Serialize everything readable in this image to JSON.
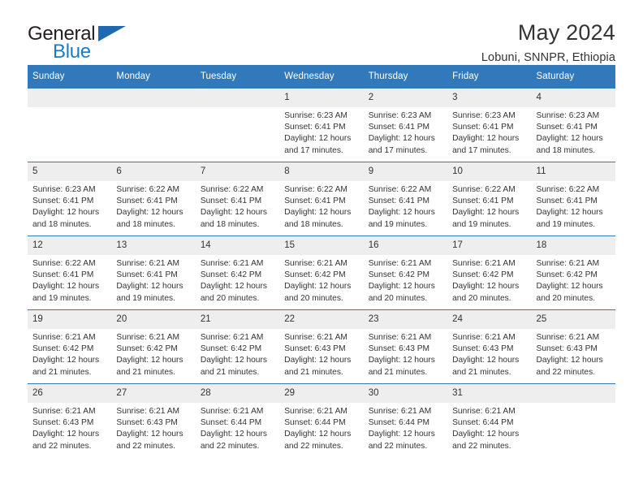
{
  "brand": {
    "name_top": "General",
    "name_bottom": "Blue",
    "logo_icon": "blue-triangle-icon"
  },
  "header": {
    "title": "May 2024",
    "subtitle": "Lobuni, SNNPR, Ethiopia"
  },
  "calendar": {
    "weekday_headers": [
      "Sunday",
      "Monday",
      "Tuesday",
      "Wednesday",
      "Thursday",
      "Friday",
      "Saturday"
    ],
    "colors": {
      "header_blue": "#3279bb",
      "daynum_band": "#eeeeee",
      "text": "#333333",
      "brand_blue": "#1f7ac4"
    },
    "weeks": [
      [
        {
          "day": "",
          "lines": []
        },
        {
          "day": "",
          "lines": []
        },
        {
          "day": "",
          "lines": []
        },
        {
          "day": "1",
          "lines": [
            "Sunrise: 6:23 AM",
            "Sunset: 6:41 PM",
            "Daylight: 12 hours",
            "and 17 minutes."
          ]
        },
        {
          "day": "2",
          "lines": [
            "Sunrise: 6:23 AM",
            "Sunset: 6:41 PM",
            "Daylight: 12 hours",
            "and 17 minutes."
          ]
        },
        {
          "day": "3",
          "lines": [
            "Sunrise: 6:23 AM",
            "Sunset: 6:41 PM",
            "Daylight: 12 hours",
            "and 17 minutes."
          ]
        },
        {
          "day": "4",
          "lines": [
            "Sunrise: 6:23 AM",
            "Sunset: 6:41 PM",
            "Daylight: 12 hours",
            "and 18 minutes."
          ]
        }
      ],
      [
        {
          "day": "5",
          "lines": [
            "Sunrise: 6:23 AM",
            "Sunset: 6:41 PM",
            "Daylight: 12 hours",
            "and 18 minutes."
          ]
        },
        {
          "day": "6",
          "lines": [
            "Sunrise: 6:22 AM",
            "Sunset: 6:41 PM",
            "Daylight: 12 hours",
            "and 18 minutes."
          ]
        },
        {
          "day": "7",
          "lines": [
            "Sunrise: 6:22 AM",
            "Sunset: 6:41 PM",
            "Daylight: 12 hours",
            "and 18 minutes."
          ]
        },
        {
          "day": "8",
          "lines": [
            "Sunrise: 6:22 AM",
            "Sunset: 6:41 PM",
            "Daylight: 12 hours",
            "and 18 minutes."
          ]
        },
        {
          "day": "9",
          "lines": [
            "Sunrise: 6:22 AM",
            "Sunset: 6:41 PM",
            "Daylight: 12 hours",
            "and 19 minutes."
          ]
        },
        {
          "day": "10",
          "lines": [
            "Sunrise: 6:22 AM",
            "Sunset: 6:41 PM",
            "Daylight: 12 hours",
            "and 19 minutes."
          ]
        },
        {
          "day": "11",
          "lines": [
            "Sunrise: 6:22 AM",
            "Sunset: 6:41 PM",
            "Daylight: 12 hours",
            "and 19 minutes."
          ]
        }
      ],
      [
        {
          "day": "12",
          "lines": [
            "Sunrise: 6:22 AM",
            "Sunset: 6:41 PM",
            "Daylight: 12 hours",
            "and 19 minutes."
          ]
        },
        {
          "day": "13",
          "lines": [
            "Sunrise: 6:21 AM",
            "Sunset: 6:41 PM",
            "Daylight: 12 hours",
            "and 19 minutes."
          ]
        },
        {
          "day": "14",
          "lines": [
            "Sunrise: 6:21 AM",
            "Sunset: 6:42 PM",
            "Daylight: 12 hours",
            "and 20 minutes."
          ]
        },
        {
          "day": "15",
          "lines": [
            "Sunrise: 6:21 AM",
            "Sunset: 6:42 PM",
            "Daylight: 12 hours",
            "and 20 minutes."
          ]
        },
        {
          "day": "16",
          "lines": [
            "Sunrise: 6:21 AM",
            "Sunset: 6:42 PM",
            "Daylight: 12 hours",
            "and 20 minutes."
          ]
        },
        {
          "day": "17",
          "lines": [
            "Sunrise: 6:21 AM",
            "Sunset: 6:42 PM",
            "Daylight: 12 hours",
            "and 20 minutes."
          ]
        },
        {
          "day": "18",
          "lines": [
            "Sunrise: 6:21 AM",
            "Sunset: 6:42 PM",
            "Daylight: 12 hours",
            "and 20 minutes."
          ]
        }
      ],
      [
        {
          "day": "19",
          "lines": [
            "Sunrise: 6:21 AM",
            "Sunset: 6:42 PM",
            "Daylight: 12 hours",
            "and 21 minutes."
          ]
        },
        {
          "day": "20",
          "lines": [
            "Sunrise: 6:21 AM",
            "Sunset: 6:42 PM",
            "Daylight: 12 hours",
            "and 21 minutes."
          ]
        },
        {
          "day": "21",
          "lines": [
            "Sunrise: 6:21 AM",
            "Sunset: 6:42 PM",
            "Daylight: 12 hours",
            "and 21 minutes."
          ]
        },
        {
          "day": "22",
          "lines": [
            "Sunrise: 6:21 AM",
            "Sunset: 6:43 PM",
            "Daylight: 12 hours",
            "and 21 minutes."
          ]
        },
        {
          "day": "23",
          "lines": [
            "Sunrise: 6:21 AM",
            "Sunset: 6:43 PM",
            "Daylight: 12 hours",
            "and 21 minutes."
          ]
        },
        {
          "day": "24",
          "lines": [
            "Sunrise: 6:21 AM",
            "Sunset: 6:43 PM",
            "Daylight: 12 hours",
            "and 21 minutes."
          ]
        },
        {
          "day": "25",
          "lines": [
            "Sunrise: 6:21 AM",
            "Sunset: 6:43 PM",
            "Daylight: 12 hours",
            "and 22 minutes."
          ]
        }
      ],
      [
        {
          "day": "26",
          "lines": [
            "Sunrise: 6:21 AM",
            "Sunset: 6:43 PM",
            "Daylight: 12 hours",
            "and 22 minutes."
          ]
        },
        {
          "day": "27",
          "lines": [
            "Sunrise: 6:21 AM",
            "Sunset: 6:43 PM",
            "Daylight: 12 hours",
            "and 22 minutes."
          ]
        },
        {
          "day": "28",
          "lines": [
            "Sunrise: 6:21 AM",
            "Sunset: 6:44 PM",
            "Daylight: 12 hours",
            "and 22 minutes."
          ]
        },
        {
          "day": "29",
          "lines": [
            "Sunrise: 6:21 AM",
            "Sunset: 6:44 PM",
            "Daylight: 12 hours",
            "and 22 minutes."
          ]
        },
        {
          "day": "30",
          "lines": [
            "Sunrise: 6:21 AM",
            "Sunset: 6:44 PM",
            "Daylight: 12 hours",
            "and 22 minutes."
          ]
        },
        {
          "day": "31",
          "lines": [
            "Sunrise: 6:21 AM",
            "Sunset: 6:44 PM",
            "Daylight: 12 hours",
            "and 22 minutes."
          ]
        },
        {
          "day": "",
          "lines": []
        }
      ]
    ]
  }
}
